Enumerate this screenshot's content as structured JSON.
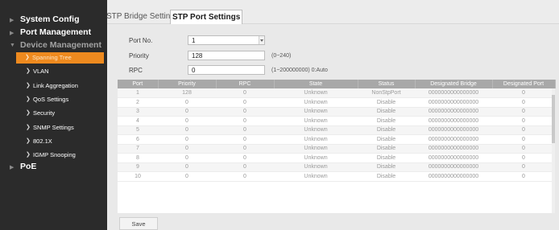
{
  "sidebar": {
    "top": [
      {
        "label": "System Config"
      },
      {
        "label": "Port Management"
      },
      {
        "label": "Device Management"
      },
      {
        "label": "PoE"
      }
    ],
    "sub": [
      {
        "label": "Spanning Tree",
        "active": true
      },
      {
        "label": "VLAN"
      },
      {
        "label": "Link Aggregation"
      },
      {
        "label": "QoS Settings"
      },
      {
        "label": "Security"
      },
      {
        "label": "SNMP Settings"
      },
      {
        "label": "802.1X"
      },
      {
        "label": "IGMP Snooping"
      }
    ]
  },
  "tabs": [
    {
      "label": "STP Bridge Settings"
    },
    {
      "label": "STP Port Settings",
      "active": true
    }
  ],
  "form": {
    "port_no_label": "Port No.",
    "port_no_value": "1",
    "priority_label": "Priority",
    "priority_value": "128",
    "priority_hint": "(0~240)",
    "rpc_label": "RPC",
    "rpc_value": "0",
    "rpc_hint": "(1~200000000) 0:Auto"
  },
  "table": {
    "headers": [
      "Port",
      "Priority",
      "RPC",
      "State",
      "Status",
      "Designated Bridge",
      "Designated Port"
    ],
    "rows": [
      [
        "1",
        "128",
        "0",
        "Unknown",
        "NonStpPort",
        "0000000000000000",
        "0"
      ],
      [
        "2",
        "0",
        "0",
        "Unknown",
        "Disable",
        "0000000000000000",
        "0"
      ],
      [
        "3",
        "0",
        "0",
        "Unknown",
        "Disable",
        "0000000000000000",
        "0"
      ],
      [
        "4",
        "0",
        "0",
        "Unknown",
        "Disable",
        "0000000000000000",
        "0"
      ],
      [
        "5",
        "0",
        "0",
        "Unknown",
        "Disable",
        "0000000000000000",
        "0"
      ],
      [
        "6",
        "0",
        "0",
        "Unknown",
        "Disable",
        "0000000000000000",
        "0"
      ],
      [
        "7",
        "0",
        "0",
        "Unknown",
        "Disable",
        "0000000000000000",
        "0"
      ],
      [
        "8",
        "0",
        "0",
        "Unknown",
        "Disable",
        "0000000000000000",
        "0"
      ],
      [
        "9",
        "0",
        "0",
        "Unknown",
        "Disable",
        "0000000000000000",
        "0"
      ],
      [
        "10",
        "0",
        "0",
        "Unknown",
        "Disable",
        "0000000000000000",
        "0"
      ]
    ]
  },
  "save_label": "Save",
  "colors": {
    "sidebar_bg": "#2b2b2b",
    "active_item": "#ee8a1f",
    "table_header": "#a8a8a8"
  }
}
